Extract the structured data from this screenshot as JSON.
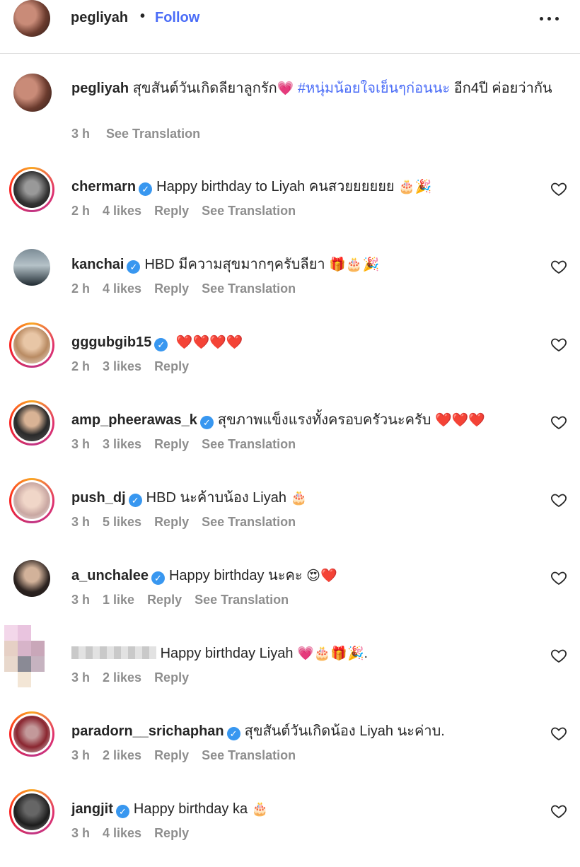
{
  "header": {
    "username": "pegliyah",
    "separator": "•",
    "follow_label": "Follow",
    "more_icon": "more-horizontal-icon"
  },
  "caption": {
    "username": "pegliyah",
    "text": "สุขสันต์วันเกิดลียาลูกรัก",
    "heart": "💗",
    "hashtag": "#หนุ่มน้อยใจเย็นๆก่อนนะ",
    "text_after": "อีก4ปี ค่อยว่ากัน",
    "time": "3 h",
    "see_translation": "See Translation"
  },
  "comments": [
    {
      "username": "chermarn",
      "verified": true,
      "text": "Happy birthday to Liyah คนสวยยยยยย",
      "emoji": "🎂🎉",
      "time": "2 h",
      "likes": "4 likes",
      "reply": "Reply",
      "see_translation": "See Translation"
    },
    {
      "username": "kanchai",
      "verified": true,
      "text": "HBD มีความสุขมากๆครับลียา",
      "emoji": "🎁🎂🎉",
      "time": "2 h",
      "likes": "4 likes",
      "reply": "Reply",
      "see_translation": "See Translation"
    },
    {
      "username": "gggubgib15",
      "verified": true,
      "text": "",
      "emoji": "❤️❤️❤️❤️",
      "time": "2 h",
      "likes": "3 likes",
      "reply": "Reply",
      "see_translation": ""
    },
    {
      "username": "amp_pheerawas_k",
      "verified": true,
      "text": "สุขภาพแข็งแรงทั้งครอบครัวนะครับ",
      "emoji": "❤️❤️❤️",
      "time": "3 h",
      "likes": "3 likes",
      "reply": "Reply",
      "see_translation": "See Translation"
    },
    {
      "username": "push_dj",
      "verified": true,
      "text": "HBD นะค้าบน้อง Liyah",
      "emoji": "🎂",
      "time": "3 h",
      "likes": "5 likes",
      "reply": "Reply",
      "see_translation": "See Translation"
    },
    {
      "username": "a_unchalee",
      "verified": true,
      "text": "Happy birthday นะคะ",
      "emoji": "😍❤️",
      "time": "3 h",
      "likes": "1 like",
      "reply": "Reply",
      "see_translation": "See Translation"
    },
    {
      "username": "",
      "verified": false,
      "text": "Happy birthday Liyah",
      "emoji": "💗🎂🎁🎉.",
      "time": "3 h",
      "likes": "2 likes",
      "reply": "Reply",
      "see_translation": ""
    },
    {
      "username": "paradorn__srichaphan",
      "verified": true,
      "text": "สุขสันต์วันเกิดน้อง Liyah นะค่าบ.",
      "emoji": "",
      "time": "3 h",
      "likes": "2 likes",
      "reply": "Reply",
      "see_translation": "See Translation"
    },
    {
      "username": "jangjit",
      "verified": true,
      "text": "Happy birthday ka",
      "emoji": "🎂",
      "time": "3 h",
      "likes": "4 likes",
      "reply": "Reply",
      "see_translation": ""
    }
  ],
  "colors": {
    "follow": "#4a6cf7",
    "hashtag": "#4a6cf7",
    "verified": "#3897f0",
    "meta": "#8e8e8e"
  }
}
